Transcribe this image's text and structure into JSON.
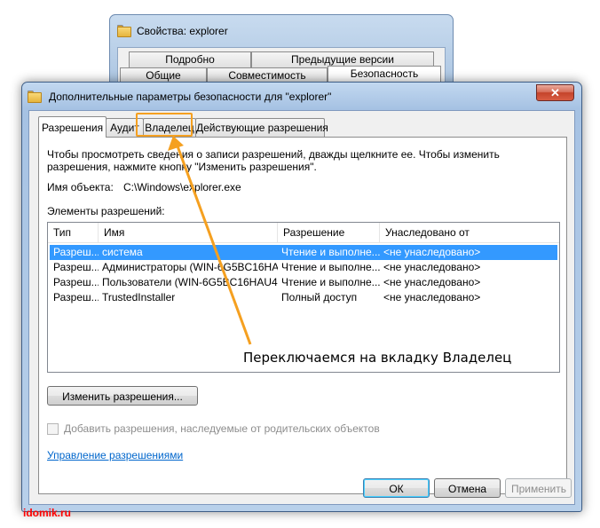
{
  "background_window": {
    "title": "Свойства: explorer",
    "tabs_row1": [
      "Подробно",
      "Предыдущие версии"
    ],
    "tabs_row2": [
      "Общие",
      "Совместимость",
      "Безопасность"
    ]
  },
  "dialog": {
    "title": "Дополнительные параметры безопасности  для  \"explorer\"",
    "close_glyph": "✕",
    "tabs": [
      "Разрешения",
      "Аудит",
      "Владелец",
      "Действующие разрешения"
    ],
    "active_tab": "Разрешения",
    "description": "Чтобы просмотреть сведения о записи разрешений, дважды щелкните ее. Чтобы изменить разрешения, нажмите кнопку \"Изменить разрешения\".",
    "object_name_label": "Имя объекта:",
    "object_name_value": "C:\\Windows\\explorer.exe",
    "entries_label": "Элементы разрешений:",
    "columns": [
      "Тип",
      "Имя",
      "Разрешение",
      "Унаследовано от"
    ],
    "rows": [
      [
        "Разреш...",
        "система",
        "Чтение и выполне...",
        "<не унаследовано>"
      ],
      [
        "Разреш...",
        "Администраторы (WIN-6G5BC16HA...",
        "Чтение и выполне...",
        "<не унаследовано>"
      ],
      [
        "Разреш...",
        "Пользователи (WIN-6G5BC16HAU4...",
        "Чтение и выполне...",
        "<не унаследовано>"
      ],
      [
        "Разреш...",
        "TrustedInstaller",
        "Полный доступ",
        "<не унаследовано>"
      ]
    ],
    "selected_row": 0,
    "change_permissions_button": "Изменить разрешения...",
    "inherit_checkbox_label": "Добавить разрешения, наследуемые от родительских объектов",
    "inherit_checked": false,
    "manage_link": "Управление разрешениями",
    "ok_button": "ОК",
    "cancel_button": "Отмена",
    "apply_button": "Применить"
  },
  "annotation": {
    "text": "Переключаемся на вкладку Владелец",
    "color": "#f5a020"
  },
  "watermark": "idomik.ru",
  "colors": {
    "selection": "#3399ff",
    "link": "#0066cc",
    "accent_annotation": "#f5a020",
    "watermark": "#ff0000"
  }
}
